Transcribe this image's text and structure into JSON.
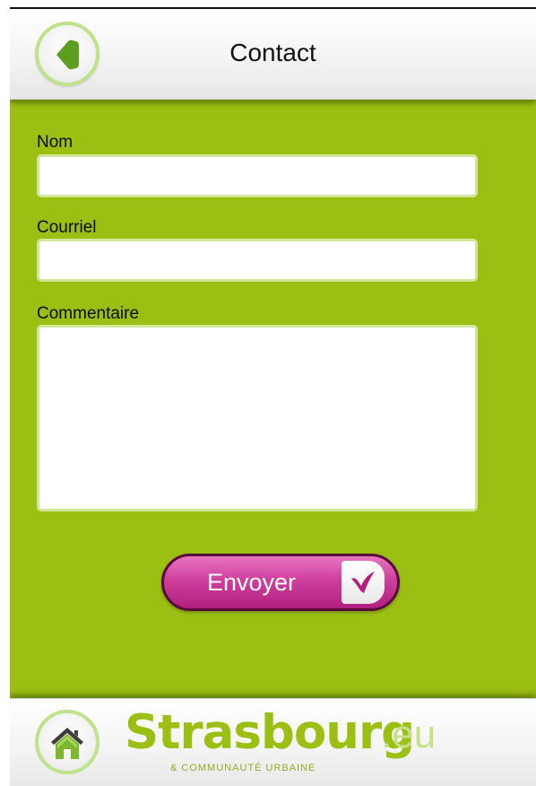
{
  "header": {
    "title": "Contact"
  },
  "form": {
    "name_label": "Nom",
    "name_value": "",
    "email_label": "Courriel",
    "email_value": "",
    "comment_label": "Commentaire",
    "comment_value": ""
  },
  "send_button": {
    "label": "Envoyer"
  },
  "footer": {
    "logo_main": "Strasbourg",
    "logo_ext": ".eu",
    "logo_sub": "& COMMUNAUTÉ URBAINE"
  },
  "colors": {
    "background_green": "#9bbf12",
    "accent_light_green": "#bfe28a",
    "button_magenta": "#cf3f9e",
    "logo_green": "#9bbf12"
  },
  "icons": {
    "back": "back-arrow-icon",
    "send": "checkmark-icon",
    "home": "home-icon"
  }
}
